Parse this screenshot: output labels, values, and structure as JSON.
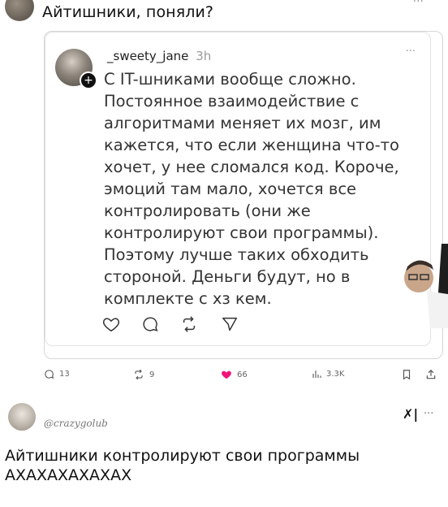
{
  "header": {
    "text": "Айтишники, поняли?"
  },
  "quoted_post": {
    "username": "_sweety_jane",
    "time": "3h",
    "text": "С IT-шниками вообще сложно. Постоянное взаимодействие с алгоритмами меняет их мозг, им кажется, что если женщина что-то хочет, у нее сломался код. Короче, эмоций там мало, хочется все контролировать (они же контролируют свои программы). Поэтому лучше таких обходить стороной. Деньги будут, но в комплекте с хз кем."
  },
  "stats": {
    "replies": "13",
    "reposts": "9",
    "likes": "66",
    "views": "3.3K"
  },
  "reply": {
    "username": "@crazygolub",
    "text": "Айтишники контролируют свои программы АХАХАХАХАХАХ",
    "logo": "✗|"
  },
  "colors": {
    "like": "#f0147a",
    "icon": "#555555",
    "border": "#d6d6d6"
  },
  "icons": [
    "more-icon",
    "reply-icon",
    "repost-icon",
    "like-icon",
    "share-icon",
    "views-icon",
    "bookmark-icon",
    "upload-icon",
    "plus-icon",
    "x-logo-icon"
  ]
}
